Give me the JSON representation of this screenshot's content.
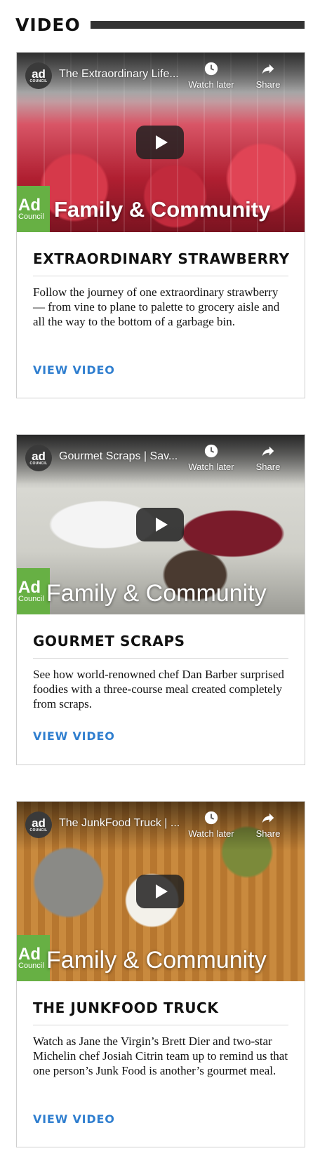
{
  "section": {
    "title": "VIDEO"
  },
  "player_ui": {
    "channel_line1": "ad",
    "channel_line2": "COUNCIL",
    "watch_later_label": "Watch later",
    "share_label": "Share",
    "logo_line1": "Ad",
    "logo_line2": "Council",
    "brand_text": "Family & Community"
  },
  "cards": [
    {
      "video_title": "The Extraordinary Life...",
      "title": "EXTRAORDINARY STRAWBERRY",
      "description": "Follow the journey of one extraordinary strawberry — from vine to plane to palette to grocery aisle and all the way to the bottom of a garbage bin.",
      "link_label": "VIEW VIDEO"
    },
    {
      "video_title": "Gourmet Scraps | Sav...",
      "title": "GOURMET SCRAPS",
      "description": "See how world-renowned chef Dan Barber surprised foodies with a three-course meal created completely from scraps.",
      "link_label": "VIEW VIDEO"
    },
    {
      "video_title": "The JunkFood Truck | ...",
      "title": "THE JUNKFOOD TRUCK",
      "description": "Watch as Jane the Virgin’s Brett Dier and two-star Michelin chef Josiah Citrin team up to remind us that one person’s Junk Food is another’s gourmet meal.",
      "link_label": "VIEW VIDEO"
    }
  ]
}
